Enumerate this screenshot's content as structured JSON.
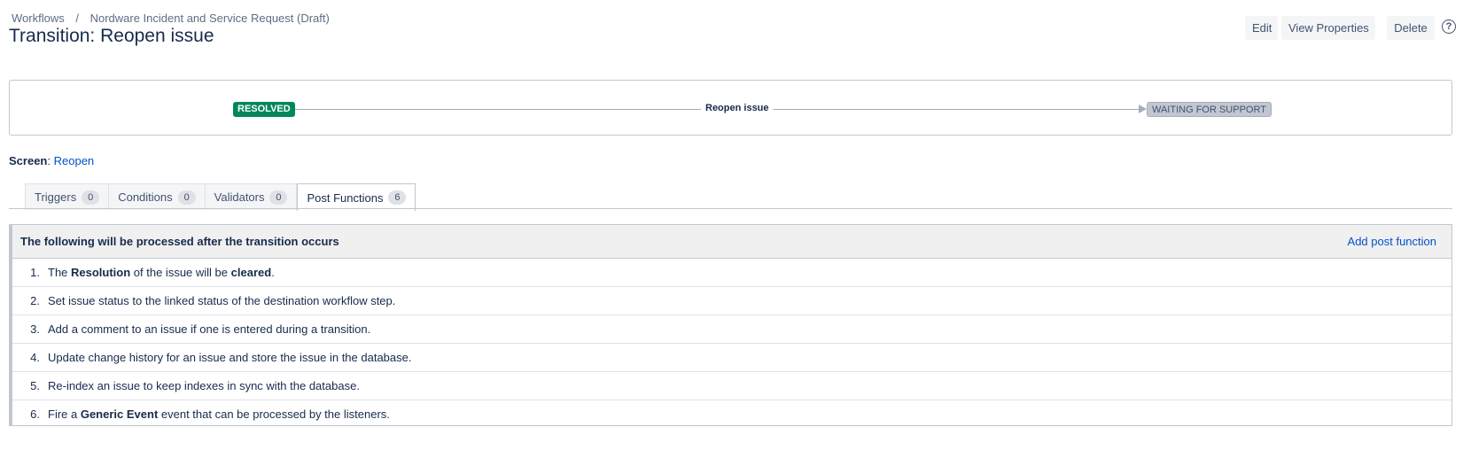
{
  "breadcrumb": {
    "workflows": "Workflows",
    "separator": "/",
    "workflow_name": "Nordware Incident and Service Request (Draft)"
  },
  "page_title": "Transition: Reopen issue",
  "toolbar": {
    "edit": "Edit",
    "view_properties": "View Properties",
    "delete": "Delete",
    "help_icon": "?"
  },
  "diagram": {
    "from_status": "RESOLVED",
    "transition_name": "Reopen issue",
    "to_status": "WAITING FOR SUPPORT",
    "colors": {
      "resolved": "#00875a",
      "waiting": "#c1c7d0"
    }
  },
  "screen": {
    "label": "Screen",
    "colon": ": ",
    "value": "Reopen"
  },
  "tabs": [
    {
      "label": "Triggers",
      "count": "0"
    },
    {
      "label": "Conditions",
      "count": "0"
    },
    {
      "label": "Validators",
      "count": "0"
    },
    {
      "label": "Post Functions",
      "count": "6"
    }
  ],
  "post_functions": {
    "heading": "The following will be processed after the transition occurs",
    "add_link": "Add post function",
    "items": [
      {
        "num": "1.",
        "p1": "The ",
        "b1": "Resolution",
        "p2": " of the issue will be ",
        "b2": "cleared",
        "p3": "."
      },
      {
        "num": "2.",
        "p1": "Set issue status to the linked status of the destination workflow step."
      },
      {
        "num": "3.",
        "p1": "Add a comment to an issue if one is entered during a transition."
      },
      {
        "num": "4.",
        "p1": "Update change history for an issue and store the issue in the database."
      },
      {
        "num": "5.",
        "p1": "Re-index an issue to keep indexes in sync with the database."
      },
      {
        "num": "6.",
        "p1": "Fire a ",
        "b1": "Generic Event",
        "p2": " event that can be processed by the listeners."
      }
    ]
  }
}
